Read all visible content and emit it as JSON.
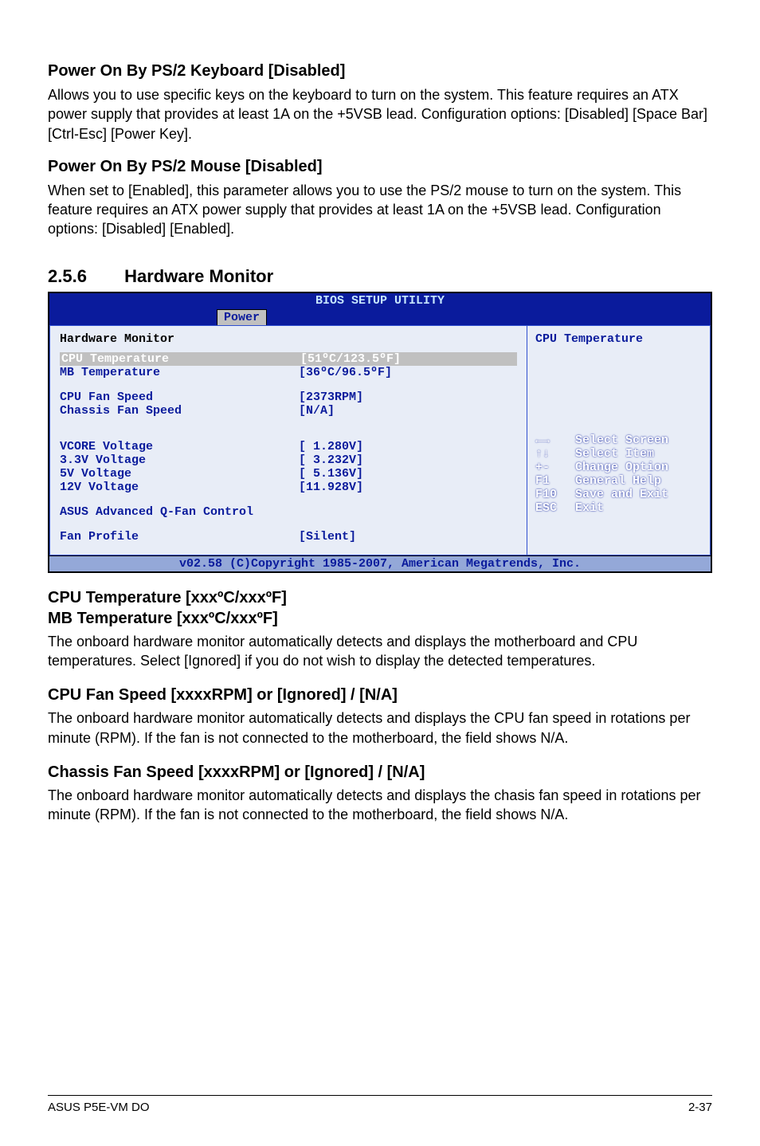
{
  "sections": {
    "kb": {
      "title": "Power On By PS/2 Keyboard [Disabled]",
      "body": "Allows you to use specific keys on the keyboard to turn on the system. This feature requires an ATX power supply that provides at least 1A on the +5VSB lead. Configuration options: [Disabled] [Space Bar] [Ctrl-Esc] [Power Key]."
    },
    "mouse": {
      "title": "Power On By PS/2 Mouse [Disabled]",
      "body": "When set to [Enabled], this parameter allows you to use the PS/2 mouse to turn on the system. This feature requires an ATX power supply that provides at least 1A on the +5VSB lead. Configuration options: [Disabled] [Enabled]."
    },
    "hwmon": {
      "num": "2.5.6",
      "title": "Hardware Monitor"
    },
    "cpu_temp": {
      "title1": "CPU Temperature [xxxºC/xxxºF]",
      "title2": "MB Temperature [xxxºC/xxxºF]",
      "body": "The onboard hardware monitor automatically detects and displays the motherboard and CPU temperatures. Select [Ignored] if you do not wish to display the detected temperatures."
    },
    "cpu_fan": {
      "title": "CPU Fan Speed [xxxxRPM] or [Ignored] / [N/A]",
      "body": "The onboard hardware monitor automatically detects and displays the CPU fan speed in rotations per minute (RPM). If the fan is not connected to the motherboard, the field shows N/A."
    },
    "chassis_fan": {
      "title": "Chassis Fan Speed [xxxxRPM] or [Ignored] / [N/A]",
      "body": "The onboard hardware monitor automatically detects and displays the chasis fan speed in rotations per minute (RPM). If the fan is not connected to the motherboard, the field shows N/A."
    }
  },
  "bios": {
    "title": "BIOS SETUP UTILITY",
    "tab": "Power",
    "left": {
      "header": "Hardware Monitor",
      "rows": [
        {
          "label": "CPU Temperature",
          "value": "[51ºC/123.5ºF]",
          "hl": true
        },
        {
          "label": "MB Temperature",
          "value": "[36ºC/96.5ºF]"
        },
        {
          "blank": true
        },
        {
          "label": "CPU Fan Speed",
          "value": "[2373RPM]"
        },
        {
          "label": "Chassis Fan Speed",
          "value": "[N/A]"
        },
        {
          "blank": true
        },
        {
          "blank": true
        },
        {
          "label": "VCORE Voltage",
          "value": "[ 1.280V]"
        },
        {
          "label": "3.3V Voltage",
          "value": "[ 3.232V]"
        },
        {
          "label": "5V Voltage",
          "value": "[ 5.136V]"
        },
        {
          "label": "12V Voltage",
          "value": "[11.928V]"
        },
        {
          "blank": true
        },
        {
          "label": "ASUS Advanced Q-Fan Control",
          "value": ""
        },
        {
          "blank": true
        },
        {
          "label": "Fan Profile",
          "value": "[Silent]"
        }
      ]
    },
    "right": {
      "help": "CPU Temperature",
      "nav": [
        {
          "k": "←→",
          "d": "Select Screen"
        },
        {
          "k": "↑↓",
          "d": "Select Item"
        },
        {
          "k": "+-",
          "d": "Change Option"
        },
        {
          "k": "F1",
          "d": "General Help"
        },
        {
          "k": "F10",
          "d": "Save and Exit"
        },
        {
          "k": "ESC",
          "d": "Exit"
        }
      ]
    },
    "footer": "v02.58 (C)Copyright 1985-2007, American Megatrends, Inc."
  },
  "page_footer": {
    "left": "ASUS P5E-VM DO",
    "right": "2-37"
  }
}
